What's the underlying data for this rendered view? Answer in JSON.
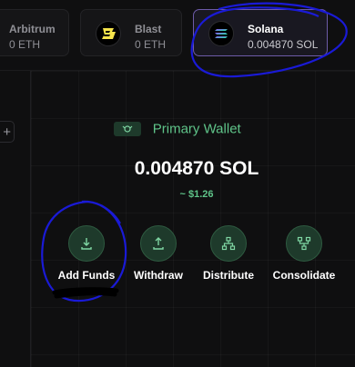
{
  "chains": [
    {
      "name": "Arbitrum",
      "balance": "0 ETH"
    },
    {
      "name": "Blast",
      "balance": "0 ETH"
    },
    {
      "name": "Solana",
      "balance": "0.004870 SOL",
      "selected": true
    }
  ],
  "sidebar": {
    "add_label": "+"
  },
  "wallet": {
    "title": "Primary Wallet",
    "balance": "0.004870 SOL",
    "usd_value": "~ $1.26"
  },
  "actions": [
    {
      "label": "Add Funds",
      "icon": "download-icon"
    },
    {
      "label": "Withdraw",
      "icon": "upload-icon"
    },
    {
      "label": "Distribute",
      "icon": "distribute-icon"
    },
    {
      "label": "Consolidate",
      "icon": "consolidate-icon"
    }
  ],
  "colors": {
    "accent_green": "#5fc489",
    "selected_border": "#6d5ba8",
    "annotation_blue": "#1a1ad6"
  }
}
